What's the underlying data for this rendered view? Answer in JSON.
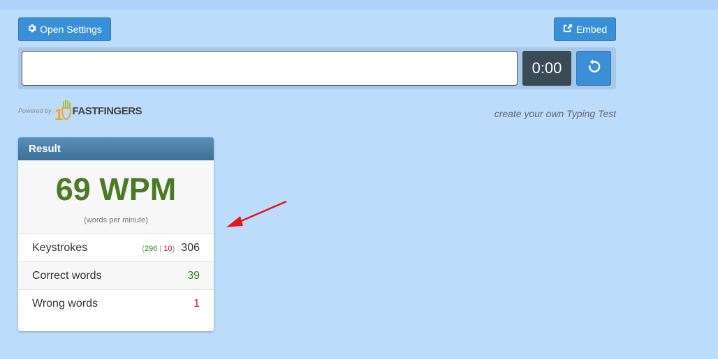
{
  "toolbar": {
    "open_settings_label": "Open Settings",
    "embed_label": "Embed"
  },
  "typing": {
    "input_value": "",
    "timer": "0:00"
  },
  "branding": {
    "powered_by": "Powered by",
    "logo_prefix": "10",
    "logo_main": "FASTFINGERS",
    "create_link": "create your own Typing Test"
  },
  "result": {
    "title": "Result",
    "wpm": "69 WPM",
    "wpm_sub": "(words per minute)",
    "rows": [
      {
        "label": "Keystrokes",
        "value": "306",
        "correct": "296",
        "separator": "|",
        "wrong": "10"
      },
      {
        "label": "Correct words",
        "value": "39"
      },
      {
        "label": "Wrong words",
        "value": "1"
      }
    ]
  },
  "colors": {
    "background": "#bcdcfb",
    "button": "#3a8fd6",
    "timer_bg": "#3b4a57",
    "wpm": "#4b7a25",
    "correct": "#2e8b1e",
    "wrong": "#d9131f",
    "annotation_arrow": "#e8141c"
  },
  "icons": {
    "settings": "gear-icon",
    "embed": "share-icon",
    "reload": "reload-icon",
    "annotation": "red-arrow-icon"
  }
}
